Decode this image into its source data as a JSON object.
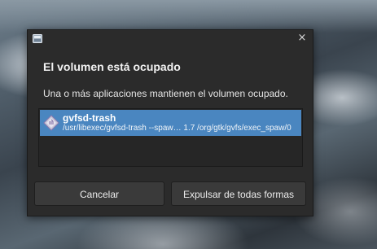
{
  "dialog": {
    "close_glyph": "×",
    "heading": "El volumen está ocupado",
    "message": "Una o más aplicaciones mantienen el volumen ocupado.",
    "apps": [
      {
        "name": "gvfsd-trash",
        "command": "/usr/libexec/gvfsd-trash --spaw… 1.7 /org/gtk/gvfs/exec_spaw/0",
        "icon": "executable-icon"
      }
    ],
    "buttons": {
      "cancel": "Cancelar",
      "eject": "Expulsar de todas formas"
    }
  },
  "colors": {
    "dialog_bg": "#2b2b2b",
    "selection": "#4a86c0",
    "button_bg": "#3a3a3a"
  }
}
